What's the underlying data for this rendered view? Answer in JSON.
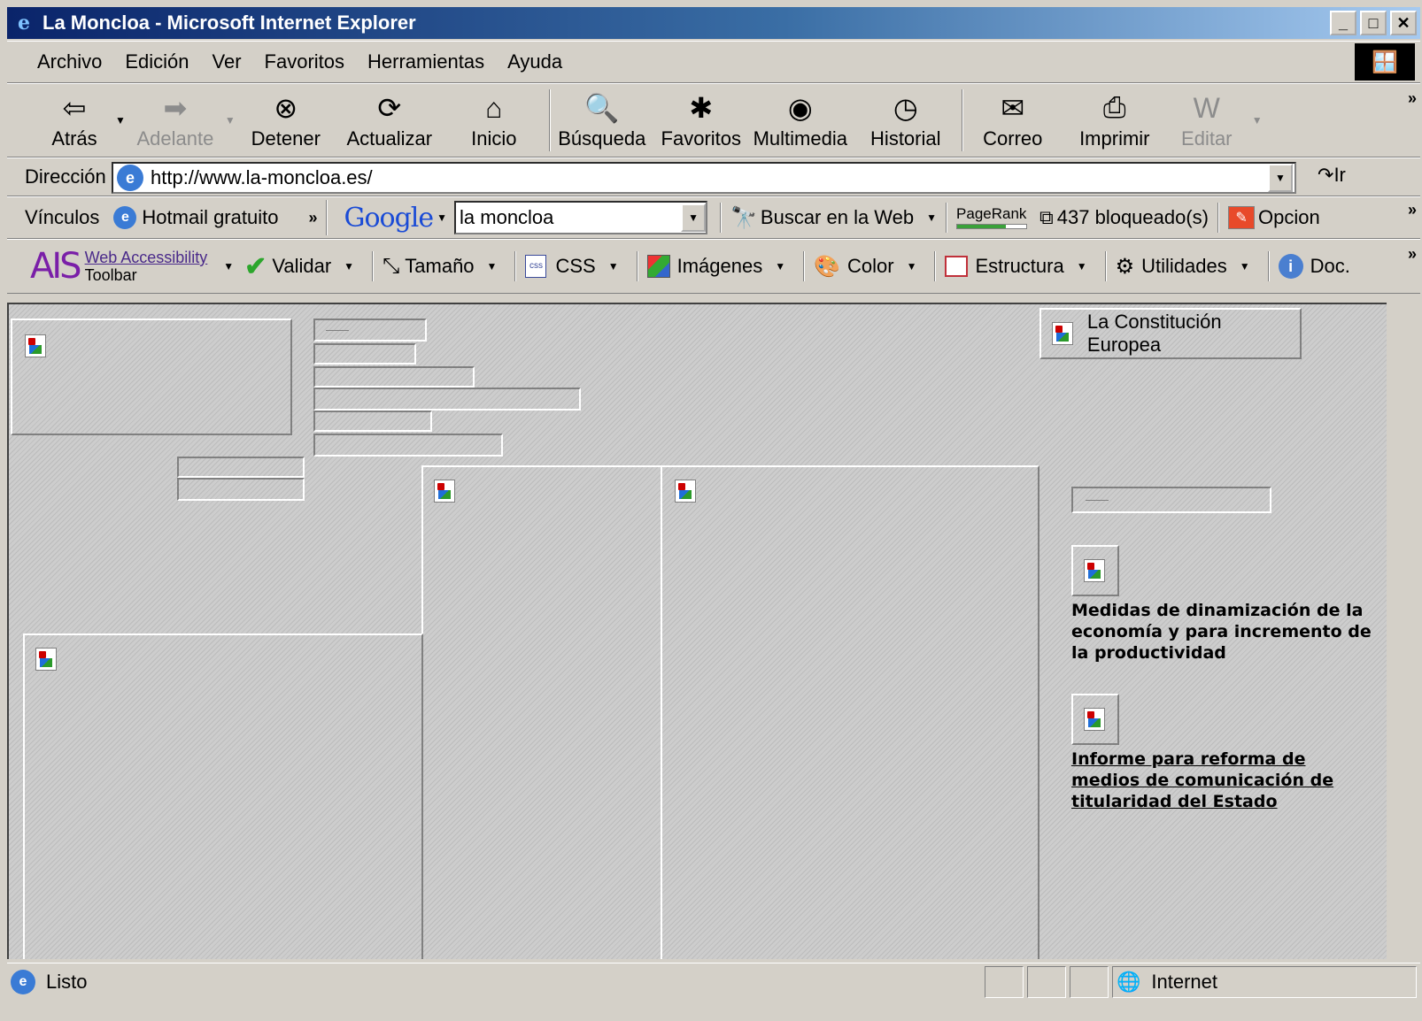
{
  "window": {
    "title": "La Moncloa - Microsoft Internet Explorer",
    "buttons": {
      "minimize": "_",
      "maximize": "□",
      "close": "✕"
    }
  },
  "menu": [
    "Archivo",
    "Edición",
    "Ver",
    "Favoritos",
    "Herramientas",
    "Ayuda"
  ],
  "toolbar": {
    "back": "Atrás",
    "forward": "Adelante",
    "stop": "Detener",
    "refresh": "Actualizar",
    "home": "Inicio",
    "search": "Búsqueda",
    "favorites": "Favoritos",
    "media": "Multimedia",
    "history": "Historial",
    "mail": "Correo",
    "print": "Imprimir",
    "edit": "Editar"
  },
  "address": {
    "label": "Dirección",
    "url": "http://www.la-moncloa.es/",
    "go": "Ir"
  },
  "links": {
    "label": "Vínculos",
    "hotmail": "Hotmail gratuito"
  },
  "google": {
    "logo": "Google",
    "query": "la moncloa",
    "search_web": "Buscar en la Web",
    "pagerank": "PageRank",
    "popups_blocked": "437 bloqueado(s)",
    "options": "Opcion"
  },
  "ais": {
    "logo": "AIS",
    "name_line1": "Web Accessibility",
    "name_line2": "Toolbar",
    "validate": "Validar",
    "size": "Tamaño",
    "css": "CSS",
    "images": "Imágenes",
    "color": "Color",
    "structure": "Estructura",
    "utilities": "Utilidades",
    "doc": "Doc."
  },
  "content": {
    "constitution": "La Constitución Europea",
    "news1": "Medidas de dinamización de la economía y para incremento de la productividad",
    "news2": "Informe para reforma de medios de comunicación de titularidad del Estado"
  },
  "status": {
    "text": "Listo",
    "zone": "Internet"
  },
  "colors": {
    "titlebar_start": "#0a246a",
    "titlebar_end": "#a6caf0",
    "chrome": "#d4d0c8"
  }
}
